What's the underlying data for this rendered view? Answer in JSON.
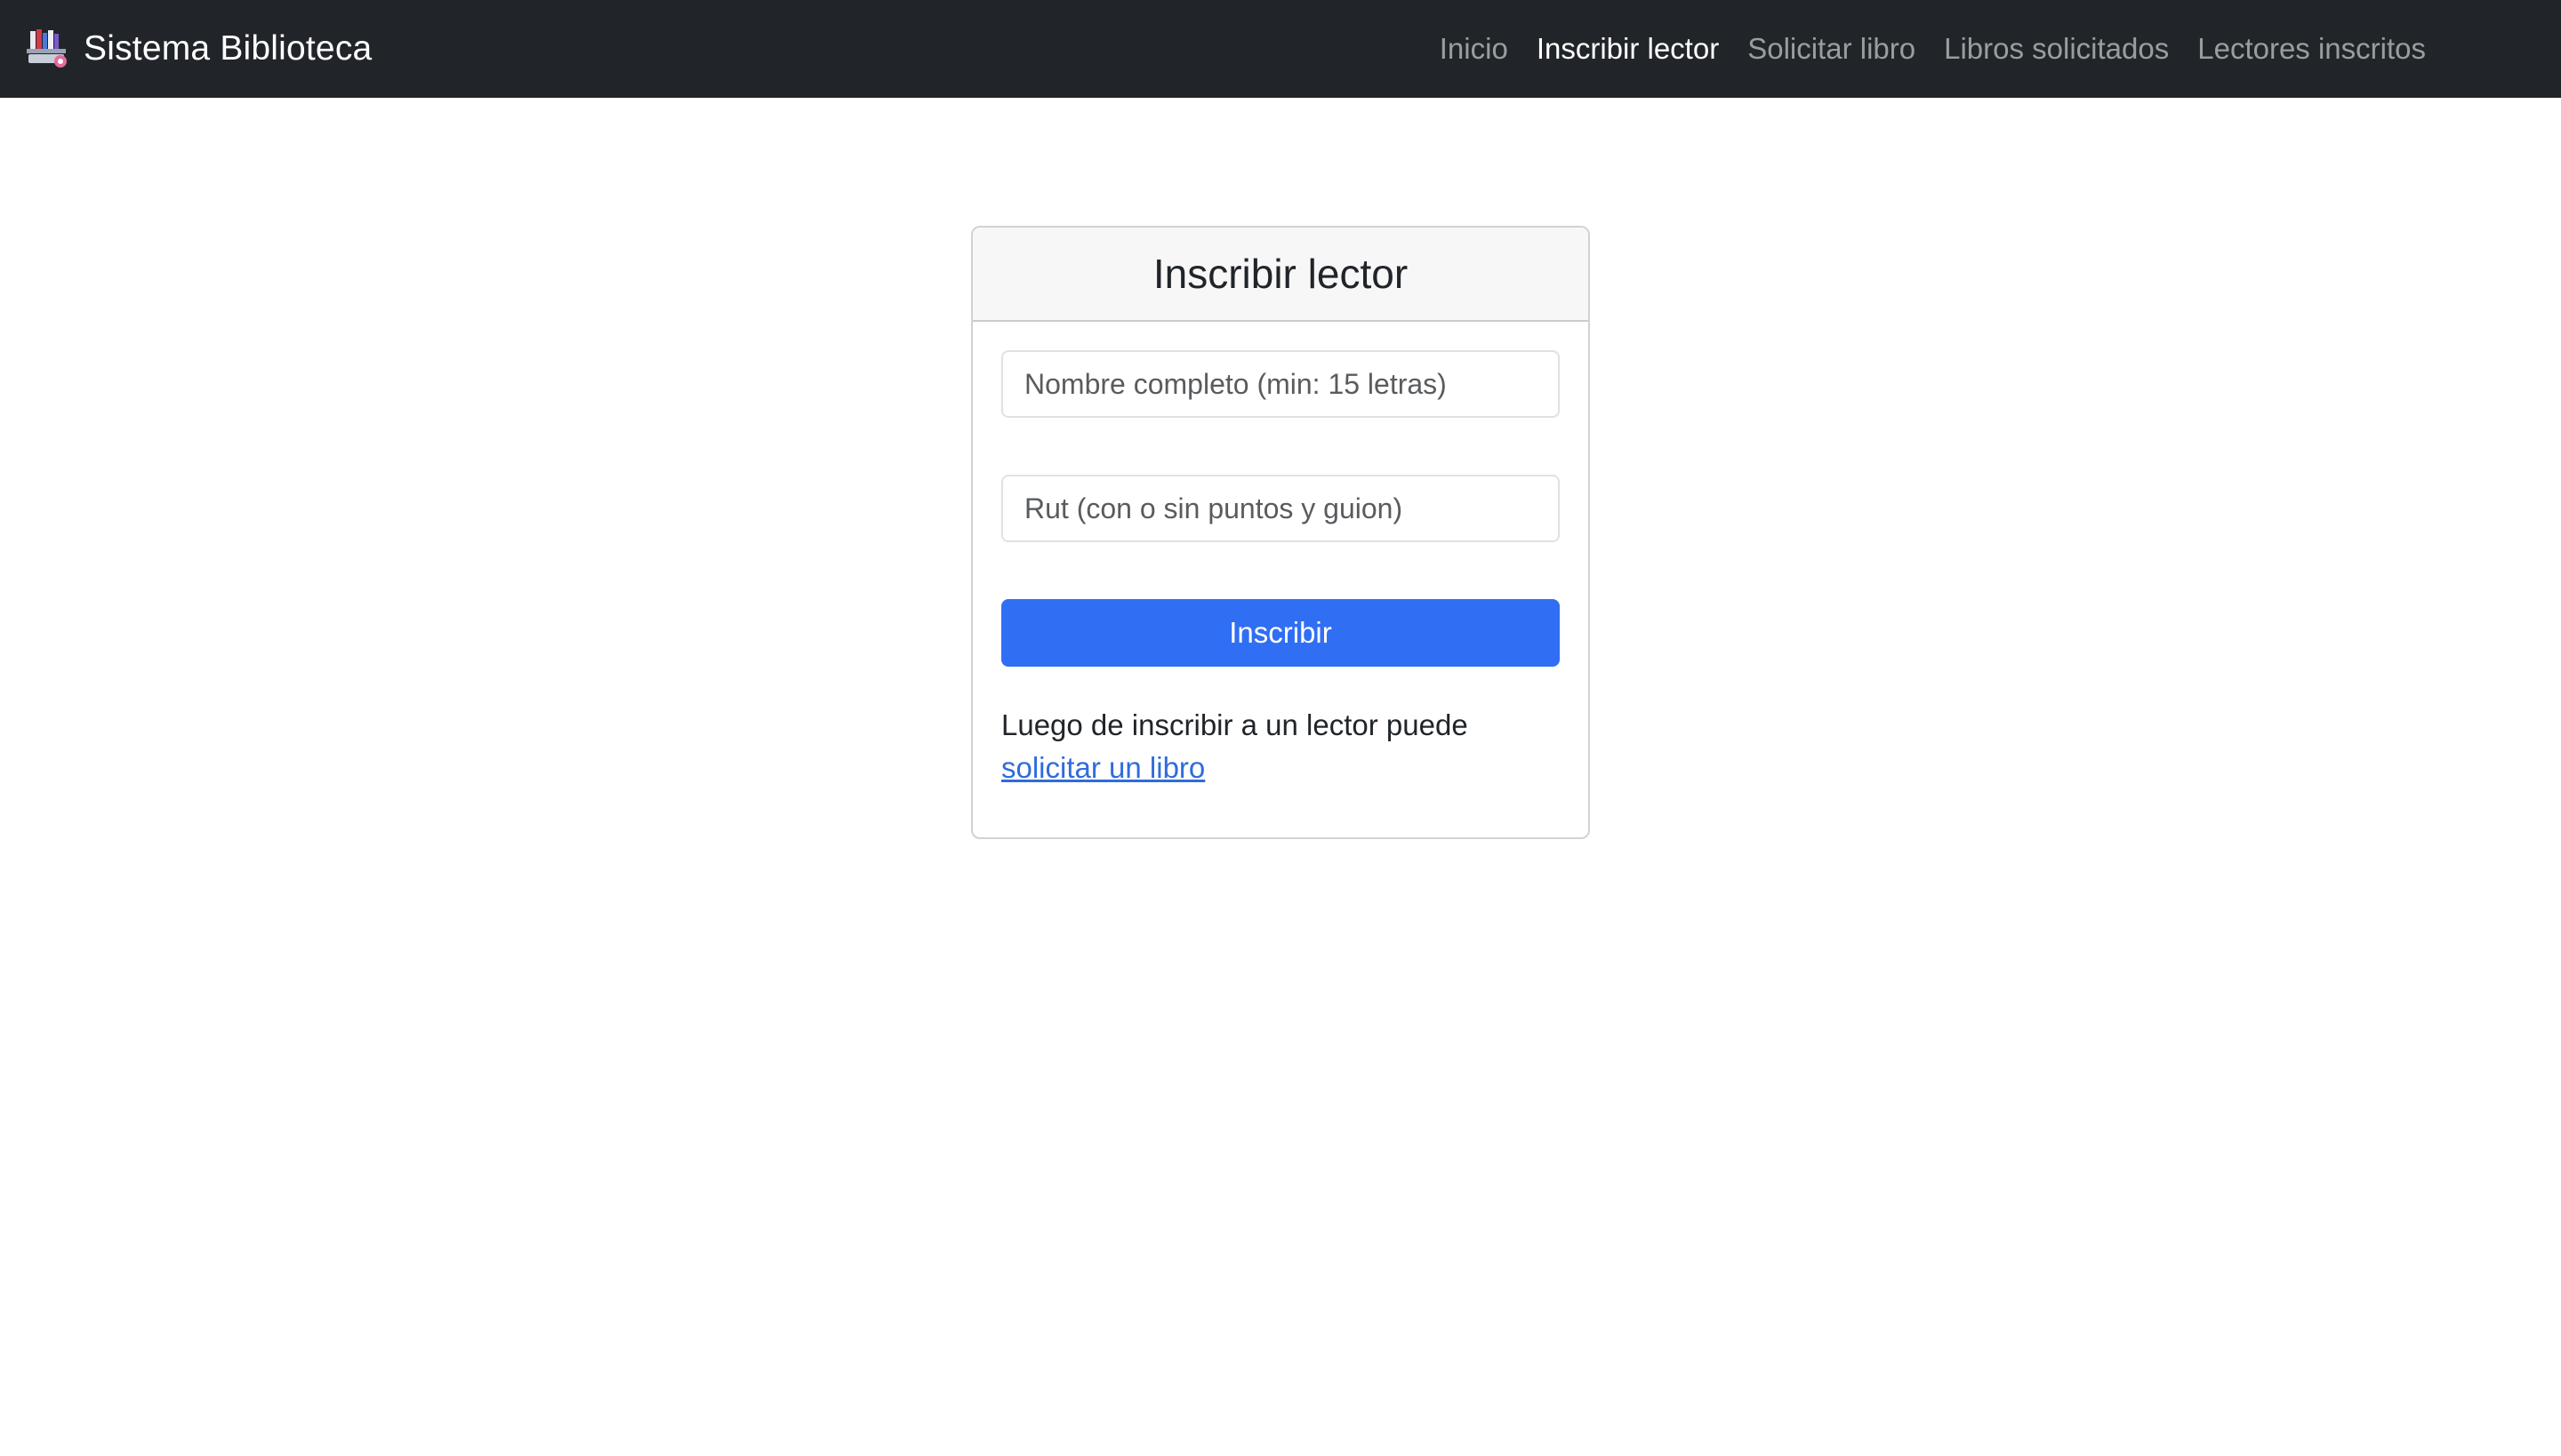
{
  "navbar": {
    "brand": "Sistema Biblioteca",
    "brand_icon": "library-logo-icon",
    "links": [
      {
        "label": "Inicio",
        "active": false
      },
      {
        "label": "Inscribir lector",
        "active": true
      },
      {
        "label": "Solicitar libro",
        "active": false
      },
      {
        "label": "Libros solicitados",
        "active": false
      },
      {
        "label": "Lectores inscritos",
        "active": false
      }
    ]
  },
  "form": {
    "title": "Inscribir lector",
    "nombre": {
      "placeholder": "Nombre completo (min: 15 letras)",
      "value": ""
    },
    "rut": {
      "placeholder": "Rut (con o sin puntos y guion)",
      "value": ""
    },
    "submit_label": "Inscribir",
    "help_text": "Luego de inscribir a un lector puede",
    "help_link": "solicitar un libro"
  },
  "colors": {
    "navbar_bg": "#212529",
    "primary": "#306ef4",
    "link": "#2f6cdc",
    "card_header_bg": "#f7f7f7"
  }
}
